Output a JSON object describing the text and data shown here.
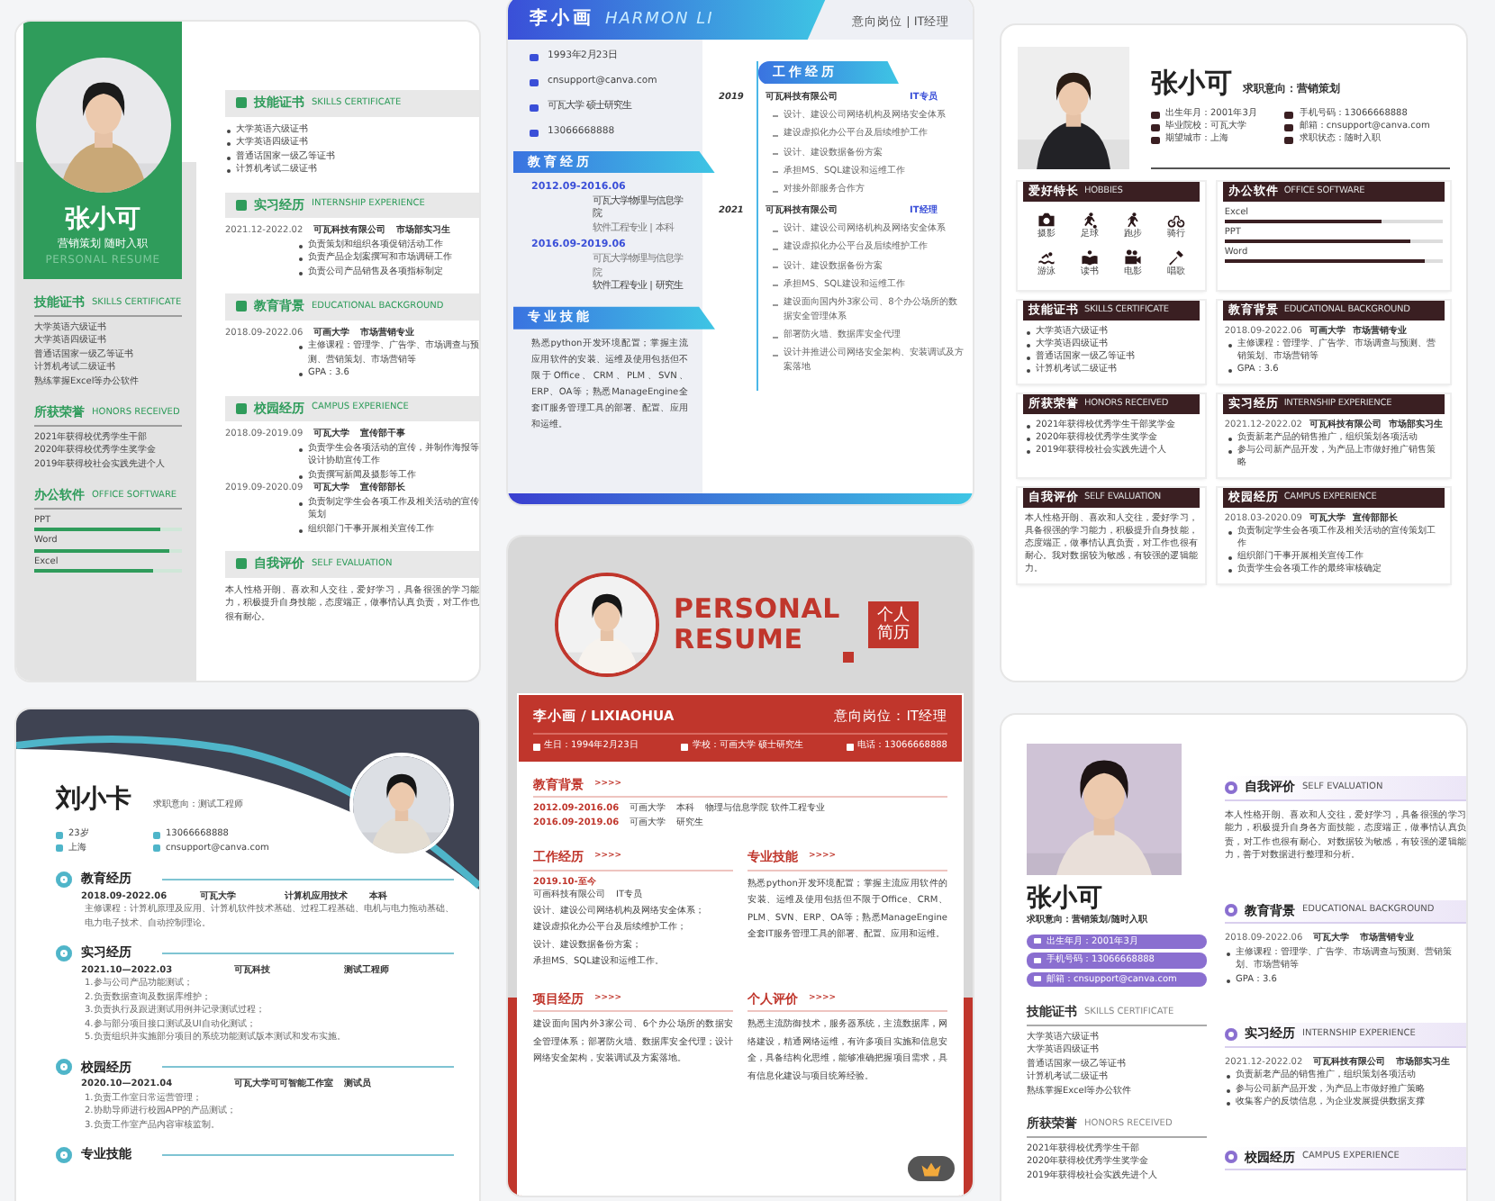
{
  "cards": [
    {
      "kind": "green",
      "name": "张小可",
      "subtitle": "营销策划 随时入职",
      "tagline": "PERSONAL RESUME",
      "left": [
        {
          "title": "技能证书",
          "en": "SKILLS CERTIFICATE",
          "lines": [
            "大学英语六级证书",
            "大学英语四级证书",
            "普通话国家一级乙等证书",
            "计算机考试二级证书",
            "熟练掌握Excel等办公软件"
          ]
        },
        {
          "title": "所获荣誉",
          "en": "HONORS RECEIVED",
          "lines": [
            "2021年获得校优秀学生干部",
            "2020年获得校优秀学生奖学金",
            "2019年获得校社会实践先进个人"
          ]
        },
        {
          "title": "办公软件",
          "en": "OFFICE SOFTWARE",
          "bars": [
            {
              "label": "PPT",
              "level": 0.85
            },
            {
              "label": "Word",
              "level": 0.92
            },
            {
              "label": "Excel",
              "level": 0.8
            }
          ]
        }
      ],
      "right": [
        {
          "title": "技能证书",
          "en": "SKILLS CERTIFICATE",
          "bullets": [
            "大学英语六级证书",
            "大学英语四级证书",
            "普通话国家一级乙等证书",
            "计算机考试二级证书"
          ]
        },
        {
          "title": "实习经历",
          "en": "INTERNSHIP EXPERIENCE",
          "entries": [
            {
              "date": "2021.12-2022.02",
              "fields": [
                "可瓦科技有限公司",
                "市场部实习生"
              ],
              "bullets": [
                "负责策划和组织各项促销活动工作",
                "负责产品企划案撰写和市场调研工作",
                "负责公司产品销售及各项指标制定"
              ]
            }
          ]
        },
        {
          "title": "教育背景",
          "en": "EDUCATIONAL BACKGROUND",
          "entries": [
            {
              "date": "2018.09-2022.06",
              "fields": [
                "可画大学",
                "市场营销专业"
              ],
              "bullets": [
                "主修课程：管理学、广告学、市场调查与预测、营销策划、市场营销等",
                "GPA：3.6"
              ]
            }
          ]
        },
        {
          "title": "校园经历",
          "en": "CAMPUS EXPERIENCE",
          "entries": [
            {
              "date": "2018.09-2019.09",
              "fields": [
                "可瓦大学",
                "宣传部干事"
              ],
              "bullets": [
                "负责学生会各项活动的宣传，并制作海报等设计协助宣传工作",
                "负责撰写新闻及摄影等工作"
              ]
            },
            {
              "date": "2019.09-2020.09",
              "fields": [
                "可瓦大学",
                "宣传部部长"
              ],
              "bullets": [
                "负责制定学生会各项工作及相关活动的宣传策划",
                "组织部门干事开展相关宣传工作"
              ]
            }
          ]
        },
        {
          "title": "自我评价",
          "en": "SELF EVALUATION",
          "text": "本人性格开朗、喜欢和人交往，爱好学习，具备很强的学习能力，积极提升自身技能，态度端正，做事情认真负责，对工作也很有耐心。"
        }
      ]
    },
    {
      "kind": "blue",
      "name": "李小画",
      "name_en": "HARMON LI",
      "intent": "意向岗位 | IT经理",
      "contacts": [
        "1993年2月23日",
        "cnsupport@canva.com",
        "可瓦大学 硕士研究生",
        "13066668888"
      ],
      "left": [
        {
          "title": "教育经历",
          "entries": [
            {
              "date": "2012.09-2016.06",
              "lines": [
                "可瓦大学物理与信息学院",
                "软件工程专业 | 本科"
              ]
            },
            {
              "date": "2016.09-2019.06",
              "lines": [
                "可瓦大学物理与信息学院",
                "软件工程专业 | 研究生"
              ]
            }
          ]
        },
        {
          "title": "专业技能",
          "text": "熟悉python开发环境配置；掌握主流应用软件的安装、运维及使用包括但不限于Office、CRM、PLM、SVN、ERP、OA等；熟悉ManageEngine全套IT服务管理工具的部署、配置、应用和运维。"
        }
      ],
      "right": [
        {
          "title": "工作经历",
          "entries": [
            {
              "fields": [
                "2019",
                "可瓦科技有限公司",
                "IT专员"
              ],
              "bullets": [
                "设计、建设公司网络机构及网络安全体系",
                "建设虚拟化办公平台及后续维护工作",
                "设计、建设数据备份方案",
                "承担MS、SQL建设和运维工作",
                "对接外部服务合作方"
              ]
            },
            {
              "fields": [
                "2021",
                "可瓦科技有限公司",
                "IT经理"
              ],
              "bullets": [
                "设计、建设公司网络机构及网络安全体系",
                "建设虚拟化办公平台及后续维护工作",
                "设计、建设数据备份方案",
                "承担MS、SQL建设和运维工作",
                "建设面向国内外3家公司、8个办公场所的数据安全管理体系",
                "部署防火墙、数据库安全代理",
                "设计并推进公司网络安全架构、安装调试及方案落地"
              ]
            }
          ]
        }
      ]
    },
    {
      "kind": "brown",
      "name": "张小可",
      "intent": "求职意向：营销策划",
      "info": [
        "出生年月：2001年3月",
        "手机号码：13066668888",
        "毕业院校：可瓦大学",
        "邮箱：cnsupport@canva.com",
        "期望城市：上海",
        "求职状态：随时入职"
      ],
      "sections": [
        {
          "title": "爱好特长",
          "en": "HOBBIES",
          "icons": [
            "摄影",
            "足球",
            "跑步",
            "骑行",
            "游泳",
            "读书",
            "电影",
            "唱歌"
          ]
        },
        {
          "title": "办公软件",
          "en": "OFFICE SOFTWARE",
          "bars": [
            {
              "label": "Excel",
              "level": 0.72
            },
            {
              "label": "PPT",
              "level": 0.85
            },
            {
              "label": "Word",
              "level": 0.92
            }
          ]
        },
        {
          "title": "技能证书",
          "en": "SKILLS CERTIFICATE",
          "bullets": [
            "大学英语六级证书",
            "大学英语四级证书",
            "普通话国家一级乙等证书",
            "计算机考试二级证书"
          ]
        },
        {
          "title": "教育背景",
          "en": "EDUCATIONAL BACKGROUND",
          "entries": [
            {
              "date": "2018.09-2022.06",
              "fields": [
                "可画大学",
                "市场营销专业"
              ],
              "bullets": [
                "主修课程：管理学、广告学、市场调查与预测、营销策划、市场营销等",
                "GPA：3.6"
              ]
            }
          ]
        },
        {
          "title": "所获荣誉",
          "en": "HONORS RECEIVED",
          "bullets": [
            "2021年获得校优秀学生干部奖学金",
            "2020年获得校优秀学生奖学金",
            "2019年获得校社会实践先进个人"
          ]
        },
        {
          "title": "实习经历",
          "en": "INTERNSHIP EXPERIENCE",
          "entries": [
            {
              "date": "2021.12-2022.02",
              "fields": [
                "可瓦科技有限公司",
                "市场部实习生"
              ],
              "bullets": [
                "负责新老产品的销售推广，组织策划各项活动",
                "参与公司新产品开发，为产品上市做好推广销售策略"
              ]
            }
          ]
        },
        {
          "title": "自我评价",
          "en": "SELF EVALUATION",
          "text": "本人性格开朗、喜欢和人交往，爱好学习，具备很强的学习能力，积极提升自身技能，态度端正，做事情认真负责，对工作也很有耐心。我对数据较为敏感，有较强的逻辑能力。"
        },
        {
          "title": "校园经历",
          "en": "CAMPUS EXPERIENCE",
          "entries": [
            {
              "date": "2018.03-2020.09",
              "fields": [
                "可瓦大学",
                "宣传部部长"
              ],
              "bullets": [
                "负责制定学生会各项工作及相关活动的宣传策划工作",
                "组织部门干事开展相关宣传工作",
                "负责学生会各项工作的最终审核确定"
              ]
            }
          ]
        }
      ]
    },
    {
      "kind": "teal",
      "name": "刘小卡",
      "intent": "求职意向：测试工程师",
      "info": [
        "23岁",
        "13066668888",
        "上海",
        "cnsupport@canva.com"
      ],
      "sections": [
        {
          "title": "教育经历",
          "entries": [
            {
              "fields": [
                "2018.09-2022.06",
                "可瓦大学",
                "计算机应用技术",
                "本科"
              ],
              "text": "主修课程：计算机原理及应用、计算机软件技术基础、过程工程基础、电机与电力拖动基础、电力电子技术、自动控制理论。"
            }
          ]
        },
        {
          "title": "实习经历",
          "entries": [
            {
              "fields": [
                "2021.10—2022.03",
                "可瓦科技",
                "测试工程师"
              ],
              "lines": [
                "1.参与公司产品功能测试；",
                "2.负责数据查询及数据库维护；",
                "3.负责执行及跟进测试用例并记录测试过程；",
                "4.参与部分项目接口测试及UI自动化测试；",
                "5.负责组织并实施部分项目的系统功能测试版本测试和发布实施。"
              ]
            }
          ]
        },
        {
          "title": "校园经历",
          "entries": [
            {
              "fields": [
                "2020.10—2021.04",
                "可瓦大学可可智能工作室",
                "测试员"
              ],
              "lines": [
                "1.负责工作室日常运营管理；",
                "2.协助导师进行校园APP的产品测试；",
                "3.负责工作室产品内容审核监制。"
              ]
            }
          ]
        },
        {
          "title": "专业技能"
        }
      ]
    },
    {
      "kind": "red",
      "title": "PERSONAL RESUME",
      "badge": "个人简历",
      "name": "李小画 / LIXIAOHUA",
      "intent": "意向岗位：IT经理",
      "info": [
        "生日：1994年2月23日",
        "学校：可画大学 硕士研究生",
        "电话：13066668888"
      ],
      "sections": [
        {
          "title": "教育背景",
          "marker": ">>>>",
          "entries": [
            {
              "date": "2012.09-2016.06",
              "fields": [
                "可画大学",
                "本科",
                "物理与信息学院 软件工程专业"
              ]
            },
            {
              "date": "2016.09-2019.06",
              "fields": [
                "可画大学",
                "研究生"
              ]
            }
          ]
        },
        {
          "title": "工作经历",
          "marker": ">>>>",
          "entries": [
            {
              "date": "2019.10-至今"
            },
            {
              "fields": [
                "可画科技有限公司",
                "IT专员"
              ],
              "lines": [
                "设计、建设公司网络机构及网络安全体系；",
                "建设虚拟化办公平台及后续维护工作；",
                "设计、建设数据备份方案；",
                "承担MS、SQL建设和运维工作。"
              ]
            }
          ]
        },
        {
          "title": "专业技能",
          "marker": ">>>>",
          "text": "熟悉python开发环境配置；掌握主流应用软件的安装、运维及使用包括但不限于Office、CRM、PLM、SVN、ERP、OA等；熟悉ManageEngine全套IT服务管理工具的部署、配置、应用和运维。"
        },
        {
          "title": "项目经历",
          "marker": ">>>>",
          "text": "建设面向国内外3家公司、6个办公场所的数据安全管理体系；部署防火墙、数据库安全代理；设计网络安全架构，安装调试及方案落地。"
        },
        {
          "title": "个人评价",
          "marker": ">>>>",
          "text": "熟悉主流防御技术，服务器系统，主流数据库，网络建设，精通网络运维，有许多项目实施和信息安全，具备结构化思维，能够准确把握项目需求，具有信息化建设与项目统筹经验。"
        }
      ]
    },
    {
      "kind": "purple",
      "name": "张小可",
      "intent": "求职意向：营销策划/随时入职",
      "info": [
        "出生年月：2001年3月",
        "手机号码：13066668888",
        "邮箱：cnsupport@canva.com"
      ],
      "left": [
        {
          "title": "技能证书",
          "en": "SKILLS CERTIFICATE",
          "lines": [
            "大学英语六级证书",
            "大学英语四级证书",
            "普通话国家一级乙等证书",
            "计算机考试二级证书",
            "熟练掌握Excel等办公软件"
          ]
        },
        {
          "title": "所获荣誉",
          "en": "HONORS RECEIVED",
          "lines": [
            "2021年获得校优秀学生干部",
            "2020年获得校优秀学生奖学金",
            "2019年获得校社会实践先进个人"
          ]
        }
      ],
      "right": [
        {
          "title": "自我评价",
          "en": "SELF EVALUATION",
          "text": "本人性格开朗、喜欢和人交往，爱好学习，具备很强的学习能力，积极提升自身各方面技能，态度端正，做事情认真负责，对工作也很有耐心。对数据较为敏感，有较强的逻辑能力，善于对数据进行整理和分析。"
        },
        {
          "title": "教育背景",
          "en": "EDUCATIONAL BACKGROUND",
          "entries": [
            {
              "date": "2018.09-2022.06",
              "fields": [
                "可瓦大学",
                "市场营销专业"
              ],
              "bullets": [
                "主修课程：管理学、广告学、市场调查与预测、营销策划、市场营销等",
                "GPA：3.6"
              ]
            }
          ]
        },
        {
          "title": "实习经历",
          "en": "INTERNSHIP EXPERIENCE",
          "entries": [
            {
              "date": "2021.12-2022.02",
              "fields": [
                "可瓦科技有限公司",
                "市场部实习生"
              ],
              "bullets": [
                "负责新老产品的销售推广，组织策划各项活动",
                "参与公司新产品开发，为产品上市做好推广策略",
                "收集客户的反馈信息，为企业发展提供数据支撑"
              ]
            }
          ]
        },
        {
          "title": "校园经历",
          "en": "CAMPUS EXPERIENCE"
        }
      ]
    }
  ]
}
